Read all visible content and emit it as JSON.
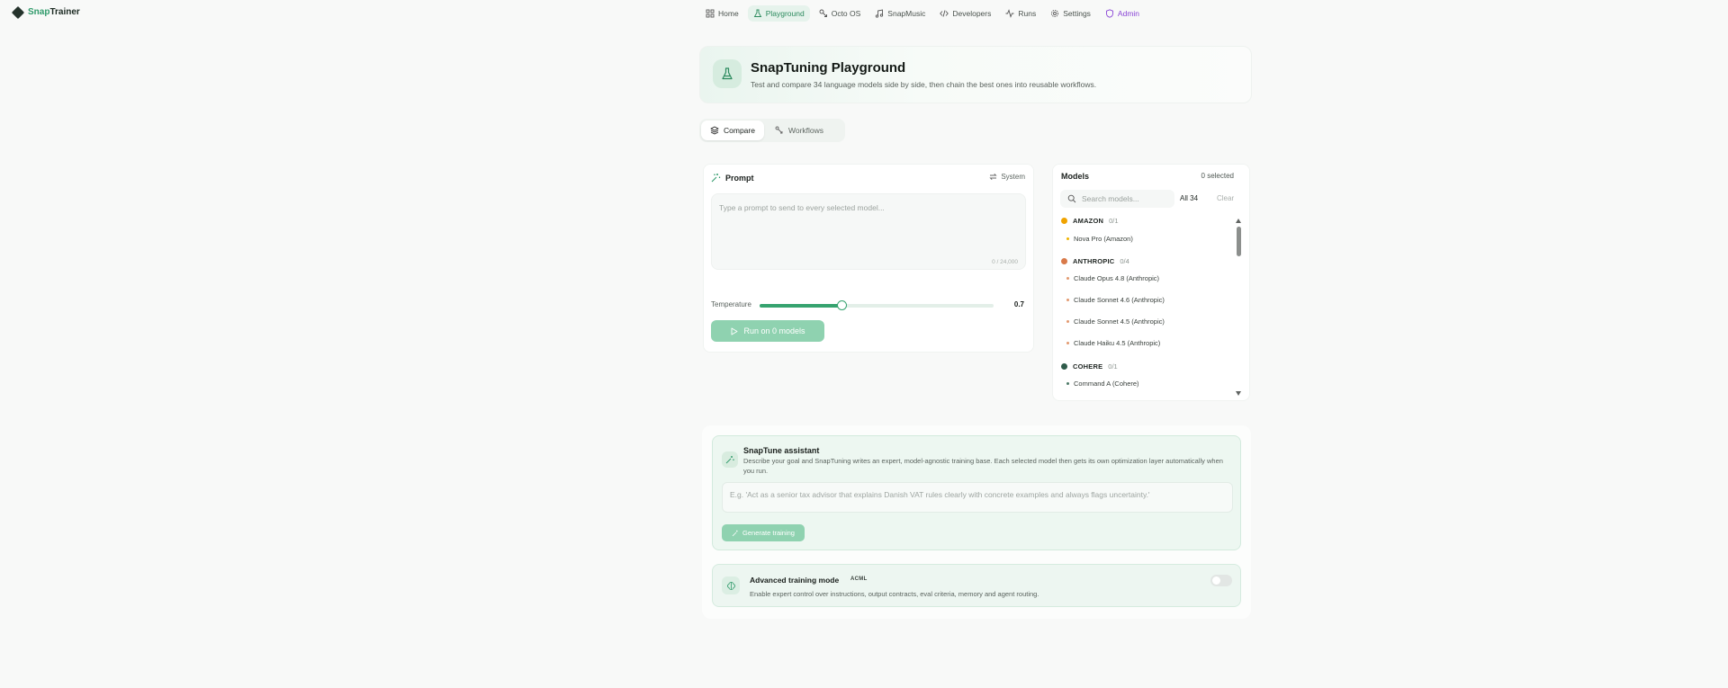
{
  "brand": {
    "prefix": "Snap",
    "suffix": "Trainer"
  },
  "nav": [
    {
      "label": "Home",
      "icon": "home-grid-icon"
    },
    {
      "label": "Playground",
      "icon": "flask-icon",
      "active": true
    },
    {
      "label": "Octo OS",
      "icon": "octo-icon"
    },
    {
      "label": "SnapMusic",
      "icon": "music-icon"
    },
    {
      "label": "Developers",
      "icon": "code-icon"
    },
    {
      "label": "Runs",
      "icon": "activity-icon"
    },
    {
      "label": "Settings",
      "icon": "gear-icon"
    },
    {
      "label": "Admin",
      "icon": "shield-icon"
    }
  ],
  "hero": {
    "title": "SnapTuning Playground",
    "subtitle": "Test and compare 34 language models side by side, then chain the best ones into reusable workflows."
  },
  "tabs": [
    {
      "label": "Compare",
      "active": true
    },
    {
      "label": "Workflows",
      "active": false
    }
  ],
  "prompt": {
    "heading": "Prompt",
    "system_label": "System",
    "placeholder": "Type a prompt to send to every selected model...",
    "char_count": "0 / 24,000",
    "temperature_label": "Temperature",
    "temperature_value": "0.7",
    "temperature_fraction": 0.35,
    "run_label": "Run on 0 models"
  },
  "models": {
    "title": "Models",
    "selected": "0 selected",
    "search_placeholder": "Search models...",
    "all_label": "All 34",
    "clear_label": "Clear",
    "groups": [
      {
        "name": "AMAZON",
        "count": "0/1",
        "color": "#f0a300",
        "items": [
          "Nova Pro (Amazon)"
        ],
        "item_color": "#f0b400"
      },
      {
        "name": "ANTHROPIC",
        "count": "0/4",
        "color": "#d97a4a",
        "items": [
          "Claude Opus 4.8 (Anthropic)",
          "Claude Sonnet 4.6 (Anthropic)",
          "Claude Sonnet 4.5 (Anthropic)",
          "Claude Haiku 4.5 (Anthropic)"
        ],
        "item_color": "#e39a70"
      },
      {
        "name": "COHERE",
        "count": "0/1",
        "color": "#2f5b4a",
        "items": [
          "Command A (Cohere)"
        ],
        "item_color": "#4d7a68"
      }
    ]
  },
  "assistant": {
    "title": "SnapTune assistant",
    "description": "Describe your goal and SnapTuning writes an expert, model-agnostic training base. Each selected model then gets its own optimization layer automatically when you run.",
    "placeholder": "E.g. 'Act as a senior tax advisor that explains Danish VAT rules clearly with concrete examples and always flags uncertainty.'",
    "button_label": "Generate training"
  },
  "advanced": {
    "title": "Advanced training mode",
    "badge": "ACML",
    "description": "Enable expert control over instructions, output contracts, eval criteria, memory and agent routing."
  }
}
